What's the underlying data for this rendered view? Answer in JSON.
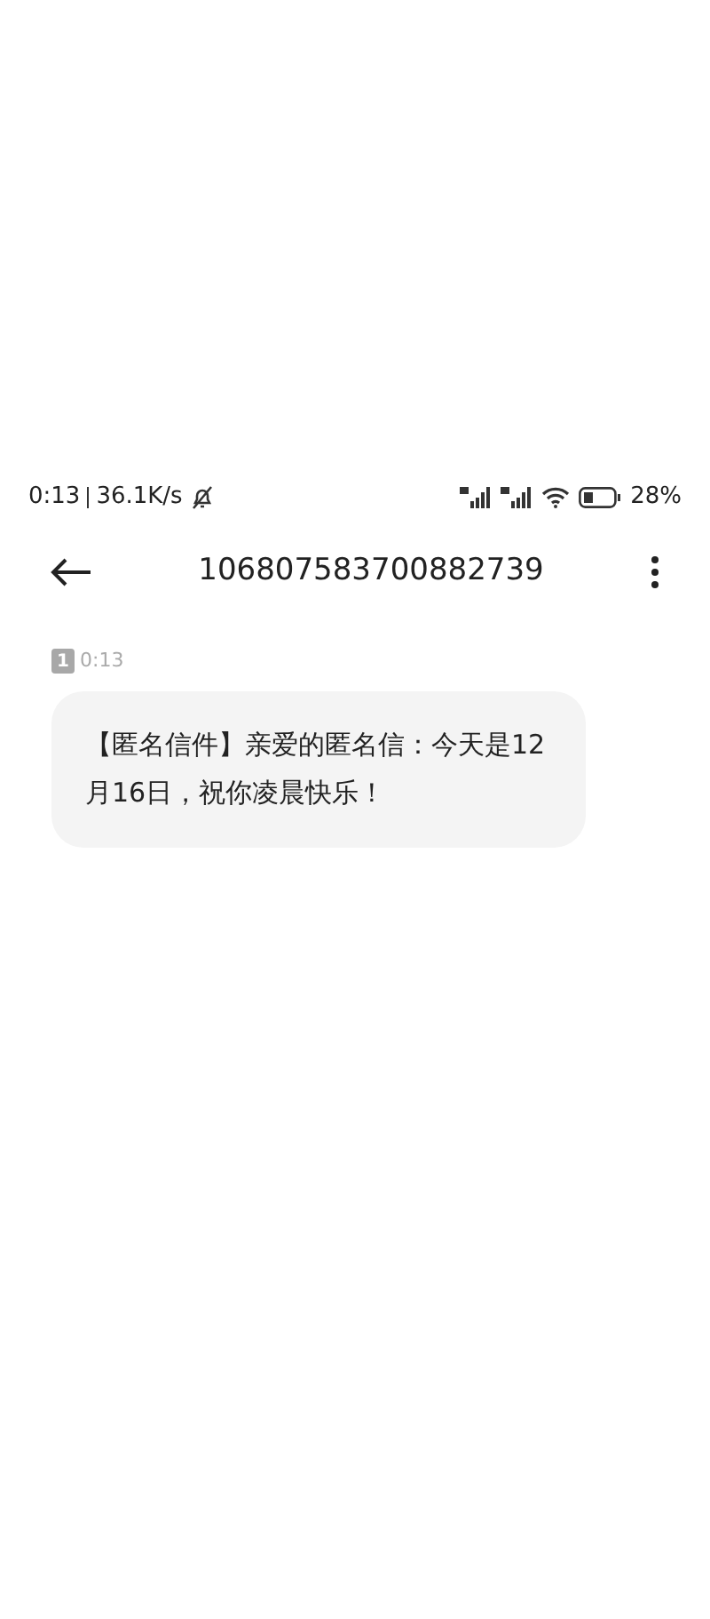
{
  "status_bar": {
    "time": "0:13",
    "speed": "36.1K/s",
    "battery": "28%"
  },
  "header": {
    "title": "106807583700882739"
  },
  "messages": [
    {
      "sim": "1",
      "time": "0:13",
      "text": "【匿名信件】亲爱的匿名信：今天是12月16日，祝你凌晨快乐！"
    }
  ]
}
